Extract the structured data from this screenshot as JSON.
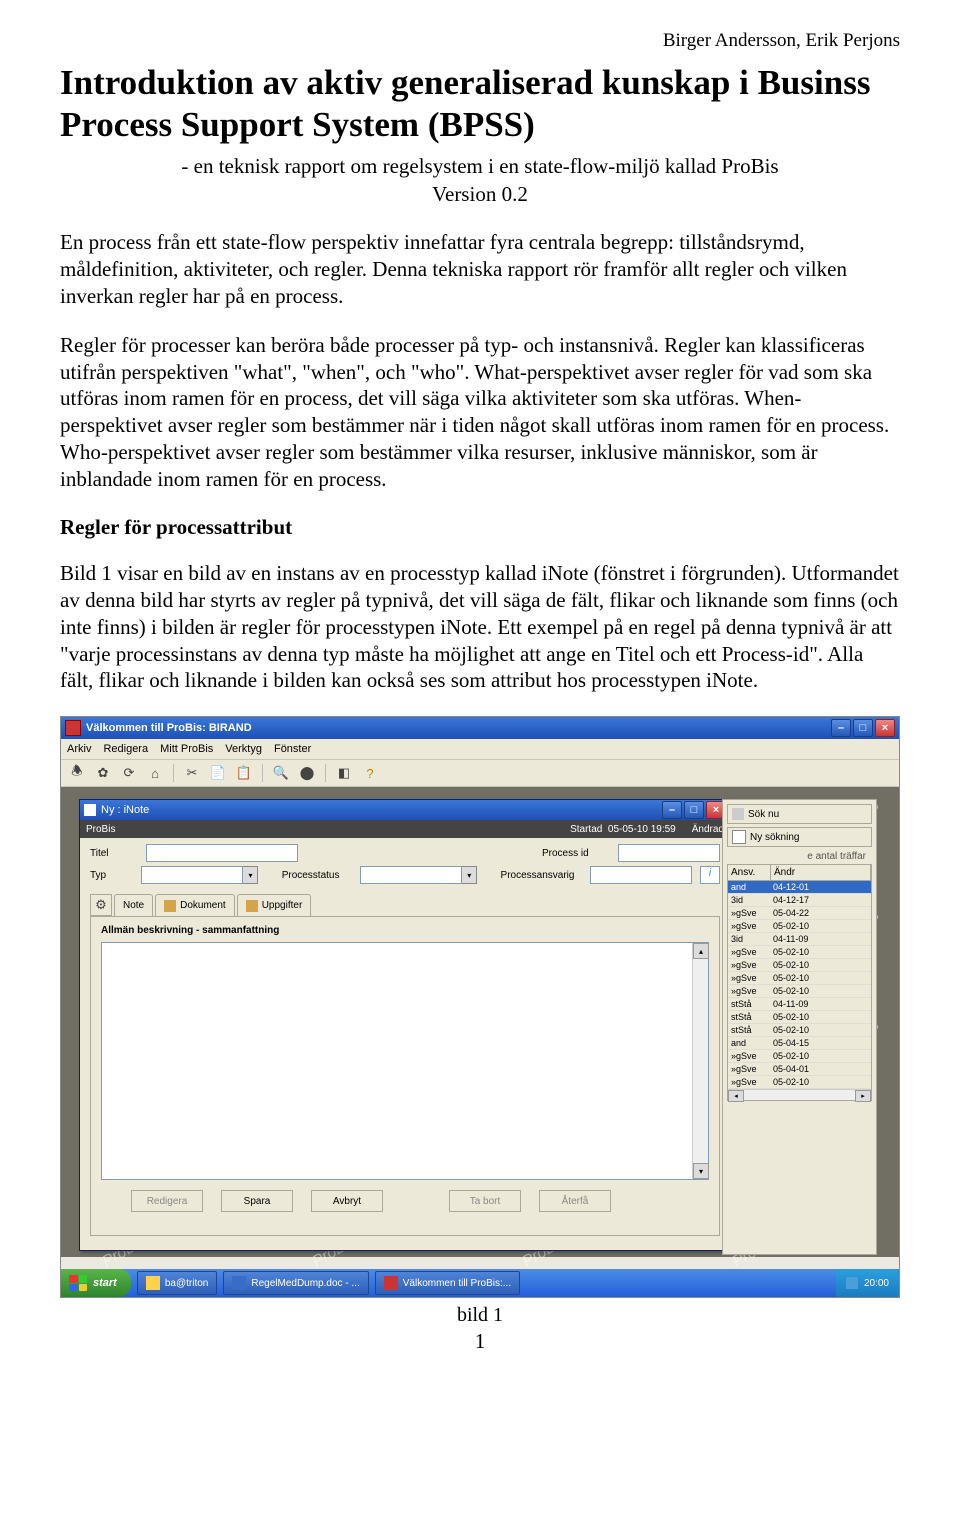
{
  "author": "Birger Andersson, Erik Perjons",
  "title": "Introduktion av aktiv generaliserad kunskap i Businss Process Support System (BPSS)",
  "subtitle": "- en teknisk rapport om regelsystem i en state-flow-miljö kallad ProBis",
  "version": "Version 0.2",
  "para1": "En process från ett state-flow perspektiv innefattar fyra centrala begrepp: tillståndsrymd, måldefinition, aktiviteter, och regler. Denna tekniska rapport rör framför allt regler och vilken inverkan regler har på en process.",
  "para2": "Regler för processer kan beröra både processer på typ- och instansnivå. Regler kan klassificeras utifrån perspektiven \"what\", \"when\", och \"who\". What-perspektivet avser regler för vad som ska utföras inom ramen för en process, det vill säga vilka aktiviteter som ska utföras. When-perspektivet avser regler som bestämmer när i tiden något skall utföras inom ramen för en process. Who-perspektivet avser regler som bestämmer vilka resurser, inklusive människor, som är inblandade inom ramen för en process.",
  "section1": "Regler för processattribut",
  "para3": "Bild 1 visar en bild av en instans av en processtyp kallad iNote (fönstret i förgrunden). Utformandet av denna bild har styrts av regler på typnivå, det vill säga de fält, flikar och liknande som finns (och inte finns) i bilden är regler för processtypen iNote. Ett exempel på en regel på denna typnivå är att \"varje processinstans av denna typ måste ha möjlighet att ange en Titel och ett Process-id\". Alla fält, flikar och liknande i bilden kan också ses som attribut hos processtypen iNote.",
  "shot": {
    "title": "Välkommen till ProBis: BIRAND",
    "menu": [
      "Arkiv",
      "Redigera",
      "Mitt ProBis",
      "Verktyg",
      "Fönster"
    ],
    "inner": {
      "title": "Ny : iNote",
      "probis": "ProBis",
      "startad_l": "Startad",
      "startad_v": "05-05-10 19:59",
      "andrad_l": "Ändrad",
      "titel_l": "Titel",
      "procid_l": "Process id",
      "typ_l": "Typ",
      "procstat_l": "Processtatus",
      "procansv_l": "Processansvarig",
      "tabs": [
        "Note",
        "Dokument",
        "Uppgifter"
      ],
      "desc": "Allmän beskrivning - sammanfattning",
      "btns": [
        "Redigera",
        "Spara",
        "Avbryt",
        "Ta bort",
        "Återfå"
      ]
    },
    "rpanel": {
      "b1": "Sök nu",
      "b2": "Ny sökning",
      "head": "e antal träffar",
      "th": [
        "Ansv.",
        "Ändr"
      ],
      "rows": [
        [
          "and",
          "04-12-01"
        ],
        [
          "3id",
          "04-12-17"
        ],
        [
          "»gSve",
          "05-04-22"
        ],
        [
          "»gSve",
          "05-02-10"
        ],
        [
          "3id",
          "04-11-09"
        ],
        [
          "»gSve",
          "05-02-10"
        ],
        [
          "»gSve",
          "05-02-10"
        ],
        [
          "»gSve",
          "05-02-10"
        ],
        [
          "»gSve",
          "05-02-10"
        ],
        [
          "stStå",
          "04-11-09"
        ],
        [
          "stStå",
          "05-02-10"
        ],
        [
          "stStå",
          "05-02-10"
        ],
        [
          "and",
          "05-04-15"
        ],
        [
          "»gSve",
          "05-02-10"
        ],
        [
          "»gSve",
          "05-04-01"
        ],
        [
          "»gSve",
          "05-02-10"
        ]
      ]
    },
    "taskbar": {
      "start": "start",
      "items": [
        "ba@triton",
        "RegelMedDump.doc - ...",
        "Välkommen till ProBis:..."
      ],
      "time": "20:00"
    },
    "watermark": "ProBis"
  },
  "caption": "bild 1",
  "pagenum": "1"
}
